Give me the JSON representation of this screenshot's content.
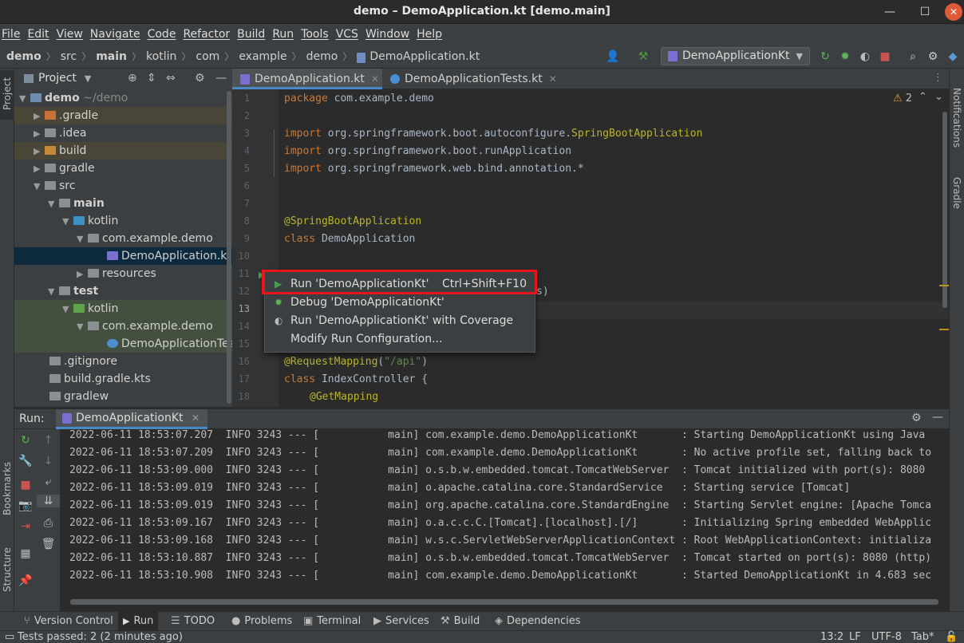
{
  "window": {
    "title": "demo – DemoApplication.kt [demo.main]"
  },
  "menu": [
    "File",
    "Edit",
    "View",
    "Navigate",
    "Code",
    "Refactor",
    "Build",
    "Run",
    "Tools",
    "VCS",
    "Window",
    "Help"
  ],
  "breadcrumb": [
    "demo",
    "src",
    "main",
    "kotlin",
    "com",
    "example",
    "demo",
    "DemoApplication.kt"
  ],
  "run_config": "DemoApplicationKt",
  "left_strip": {
    "project": "Project",
    "bookmarks": "Bookmarks",
    "structure": "Structure"
  },
  "right_strip": {
    "notifications": "Notifications",
    "gradle": "Gradle"
  },
  "project_panel": {
    "title": "Project",
    "tree": [
      {
        "label": "demo",
        "suffix": " ~/demo",
        "bold": true
      },
      {
        "label": ".gradle"
      },
      {
        "label": ".idea"
      },
      {
        "label": "build"
      },
      {
        "label": "gradle"
      },
      {
        "label": "src"
      },
      {
        "label": "main"
      },
      {
        "label": "kotlin"
      },
      {
        "label": "com.example.demo"
      },
      {
        "label": "DemoApplication.kt"
      },
      {
        "label": "resources"
      },
      {
        "label": "test"
      },
      {
        "label": "kotlin"
      },
      {
        "label": "com.example.demo"
      },
      {
        "label": "DemoApplicationTests.kt"
      },
      {
        "label": ".gitignore"
      },
      {
        "label": "build.gradle.kts"
      },
      {
        "label": "gradlew"
      }
    ]
  },
  "editor_tabs": [
    {
      "label": "DemoApplication.kt"
    },
    {
      "label": "DemoApplicationTests.kt"
    }
  ],
  "editor": {
    "warning_count": "2",
    "line_numbers": [
      "1",
      "2",
      "3",
      "4",
      "5",
      "6",
      "7",
      "8",
      "9",
      "10",
      "11",
      "12",
      "13",
      "14",
      "15",
      "16",
      "17",
      "18"
    ],
    "lines": {
      "l1_kw": "package",
      "l1_rest": " com.example.demo",
      "l3_kw": "import",
      "l3_rest": " org.springframework.boot.autoconfigure.",
      "l3_ann": "SpringBootApplication",
      "l4_kw": "import",
      "l4_rest": " org.springframework.boot.runApplication",
      "l5_kw": "import",
      "l5_rest": " org.springframework.web.bind.annotation.*",
      "l8_ann": "@SpringBootApplication",
      "l9_kw": "class",
      "l9_rest": " DemoApplication",
      "l12_rest": "s)",
      "l16_ann": "@RequestMapping",
      "l16_p1": "(",
      "l16_str": "\"/api\"",
      "l16_p2": ")",
      "l17_kw": "class",
      "l17_rest": " IndexController {",
      "l18_ann": "@GetMapping"
    }
  },
  "context_menu": {
    "items": [
      {
        "label": "Run 'DemoApplicationKt'",
        "shortcut": "Ctrl+Shift+F10"
      },
      {
        "label": "Debug 'DemoApplicationKt'"
      },
      {
        "label": "Run 'DemoApplicationKt' with Coverage"
      },
      {
        "label": "Modify Run Configuration..."
      }
    ]
  },
  "run_panel": {
    "title": "Run:",
    "tab": "DemoApplicationKt",
    "log": [
      "2022-06-11 18:53:07.207  INFO 3243 --- [           main] com.example.demo.DemoApplicationKt       : Starting DemoApplicationKt using Java",
      "2022-06-11 18:53:07.209  INFO 3243 --- [           main] com.example.demo.DemoApplicationKt       : No active profile set, falling back to",
      "2022-06-11 18:53:09.000  INFO 3243 --- [           main] o.s.b.w.embedded.tomcat.TomcatWebServer  : Tomcat initialized with port(s): 8080",
      "2022-06-11 18:53:09.019  INFO 3243 --- [           main] o.apache.catalina.core.StandardService   : Starting service [Tomcat]",
      "2022-06-11 18:53:09.019  INFO 3243 --- [           main] org.apache.catalina.core.StandardEngine  : Starting Servlet engine: [Apache Tomca",
      "2022-06-11 18:53:09.167  INFO 3243 --- [           main] o.a.c.c.C.[Tomcat].[localhost].[/]       : Initializing Spring embedded WebApplic",
      "2022-06-11 18:53:09.168  INFO 3243 --- [           main] w.s.c.ServletWebServerApplicationContext : Root WebApplicationContext: initializa",
      "2022-06-11 18:53:10.887  INFO 3243 --- [           main] o.s.b.w.embedded.tomcat.TomcatWebServer  : Tomcat started on port(s): 8080 (http)",
      "2022-06-11 18:53:10.908  INFO 3243 --- [           main] com.example.demo.DemoApplicationKt       : Started DemoApplicationKt in 4.683 sec"
    ]
  },
  "tool_tabs": [
    {
      "label": "Version Control"
    },
    {
      "label": "Run"
    },
    {
      "label": "TODO"
    },
    {
      "label": "Problems"
    },
    {
      "label": "Terminal"
    },
    {
      "label": "Services"
    },
    {
      "label": "Build"
    },
    {
      "label": "Dependencies"
    }
  ],
  "status": {
    "message": "Tests passed: 2 (2 minutes ago)",
    "position": "13:2",
    "line_ending": "LF",
    "encoding": "UTF-8",
    "indent": "Tab*"
  },
  "colors": {
    "accent": "#4a88c7",
    "highlight_box": "#e8141c",
    "run_green": "#499c54"
  }
}
